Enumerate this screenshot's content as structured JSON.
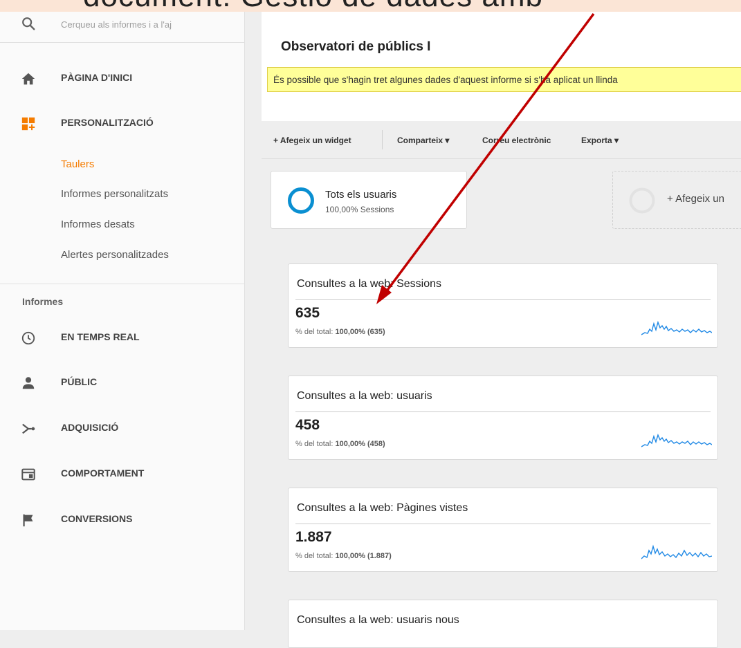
{
  "banner": {
    "text": "document.   Gestió de dades amb"
  },
  "sidebar": {
    "search_placeholder": "Cerqueu als informes i a l'aj",
    "home": "PÀGINA D'INICI",
    "customization": "PERSONALITZACIÓ",
    "sub_items": [
      "Taulers",
      "Informes personalitzats",
      "Informes desats",
      "Alertes personalitzades"
    ],
    "reports_label": "Informes",
    "reports": [
      "EN TEMPS REAL",
      "PÚBLIC",
      "ADQUISICIÓ",
      "COMPORTAMENT",
      "CONVERSIONS"
    ]
  },
  "main": {
    "title": "Observatori de públics I",
    "notice": "És possible que s'hagin tret algunes dades d'aquest informe si s'ha aplicat un llinda",
    "toolbar": {
      "add_widget": "+ Afegeix un widget",
      "share": "Comparteix ▾",
      "email": "Correu electrònic",
      "export": "Exporta ▾"
    },
    "segment": {
      "name": "Tots els usuaris",
      "sub": "100,00% Sessions"
    },
    "add_segment": "+ Afegeix un",
    "widgets": [
      {
        "title": "Consultes a la web: Sessions",
        "value": "635",
        "total_label": "% del total:",
        "total_value": "100,00% (635)"
      },
      {
        "title": "Consultes a la web: usuaris",
        "value": "458",
        "total_label": "% del total:",
        "total_value": "100,00% (458)"
      },
      {
        "title": "Consultes a la web: Pàgines vistes",
        "value": "1.887",
        "total_label": "% del total:",
        "total_value": "100,00% (1.887)"
      },
      {
        "title": "Consultes a la web: usuaris nous"
      }
    ]
  },
  "colors": {
    "accent": "#f57c00",
    "link_blue": "#1e88e5",
    "notice_bg": "#ffff99",
    "arrow": "#c00000"
  },
  "icons": [
    "search-icon",
    "home-icon",
    "dashboard-plus-icon",
    "clock-icon",
    "person-icon",
    "acquisition-icon",
    "behavior-icon",
    "flag-icon"
  ]
}
